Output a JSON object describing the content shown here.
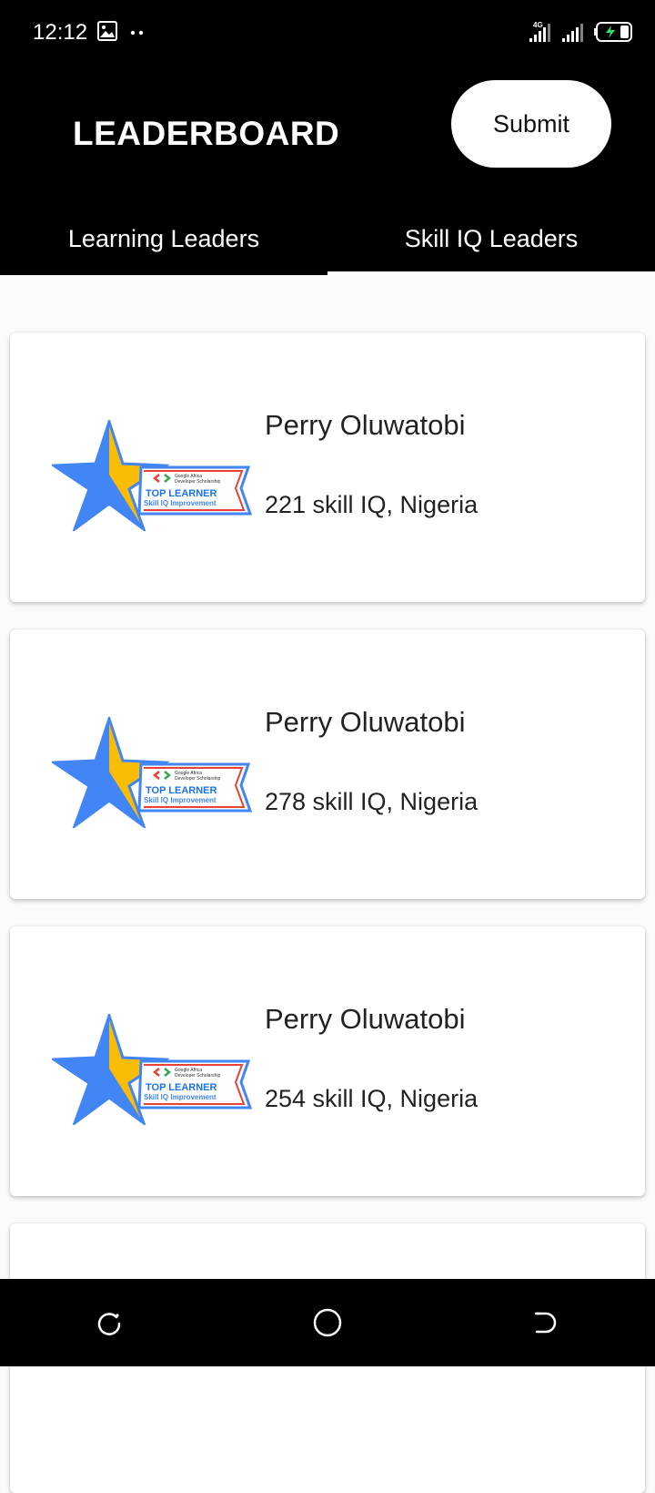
{
  "status_bar": {
    "time": "12:12",
    "network_label": "4G",
    "icons": [
      "image-icon",
      "more-dots-icon",
      "signal-4g-icon",
      "signal-icon",
      "battery-charging-icon"
    ]
  },
  "header": {
    "title": "LEADERBOARD",
    "submit_label": "Submit"
  },
  "tabs": [
    {
      "label": "Learning Leaders",
      "selected": false
    },
    {
      "label": "Skill IQ Leaders",
      "selected": true
    }
  ],
  "badge": {
    "org": "Google Africa",
    "program": "Developer Scholarship",
    "title": "TOP LEARNER",
    "subtitle": "Skill IQ Improvement",
    "colors": {
      "blue": "#4285f4",
      "yellow": "#fbbc05",
      "red": "#ea4335",
      "green": "#34a853"
    }
  },
  "leaders": [
    {
      "name": "Perry Oluwatobi",
      "detail": "221 skill IQ, Nigeria"
    },
    {
      "name": "Perry Oluwatobi",
      "detail": "278 skill IQ, Nigeria"
    },
    {
      "name": "Perry Oluwatobi",
      "detail": "254 skill IQ, Nigeria"
    }
  ],
  "nav_bar": {
    "icons": [
      "recents-icon",
      "home-icon",
      "back-icon"
    ]
  }
}
